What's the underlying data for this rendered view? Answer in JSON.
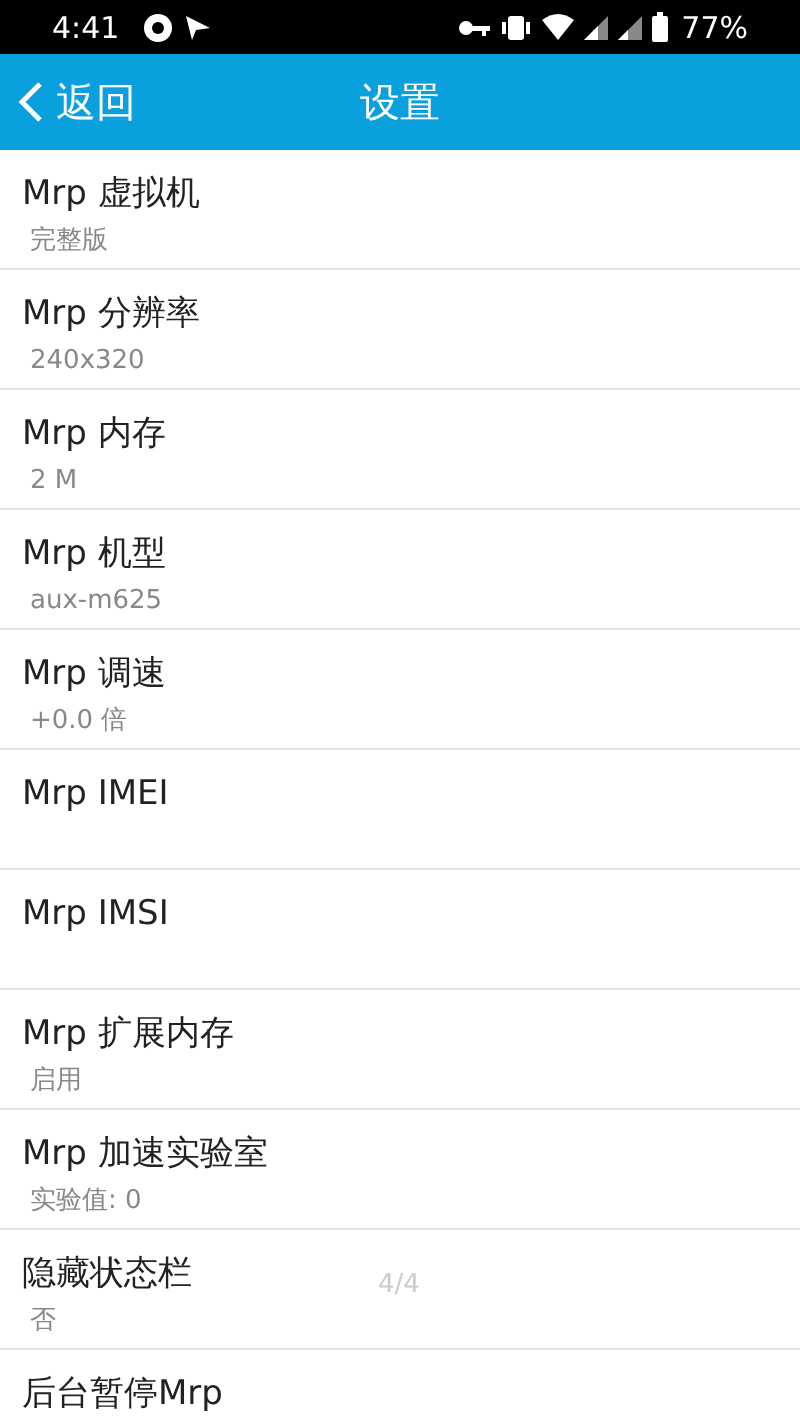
{
  "status_bar": {
    "time": "4:41",
    "battery": "77%"
  },
  "header": {
    "back": "返回",
    "title": "设置"
  },
  "settings": [
    {
      "title": "Mrp 虚拟机",
      "summary": "完整版"
    },
    {
      "title": "Mrp 分辨率",
      "summary": "240x320"
    },
    {
      "title": "Mrp 内存",
      "summary": "2 M"
    },
    {
      "title": "Mrp 机型",
      "summary": "aux-m625"
    },
    {
      "title": "Mrp 调速",
      "summary": "+0.0 倍"
    },
    {
      "title": "Mrp IMEI"
    },
    {
      "title": "Mrp IMSI"
    },
    {
      "title": "Mrp 扩展内存",
      "summary": "启用"
    },
    {
      "title": "Mrp 加速实验室",
      "summary": "实验值: 0"
    },
    {
      "title": "隐藏状态栏",
      "summary": "否"
    },
    {
      "title": "后台暂停Mrp"
    }
  ],
  "page_indicator": "4/4"
}
